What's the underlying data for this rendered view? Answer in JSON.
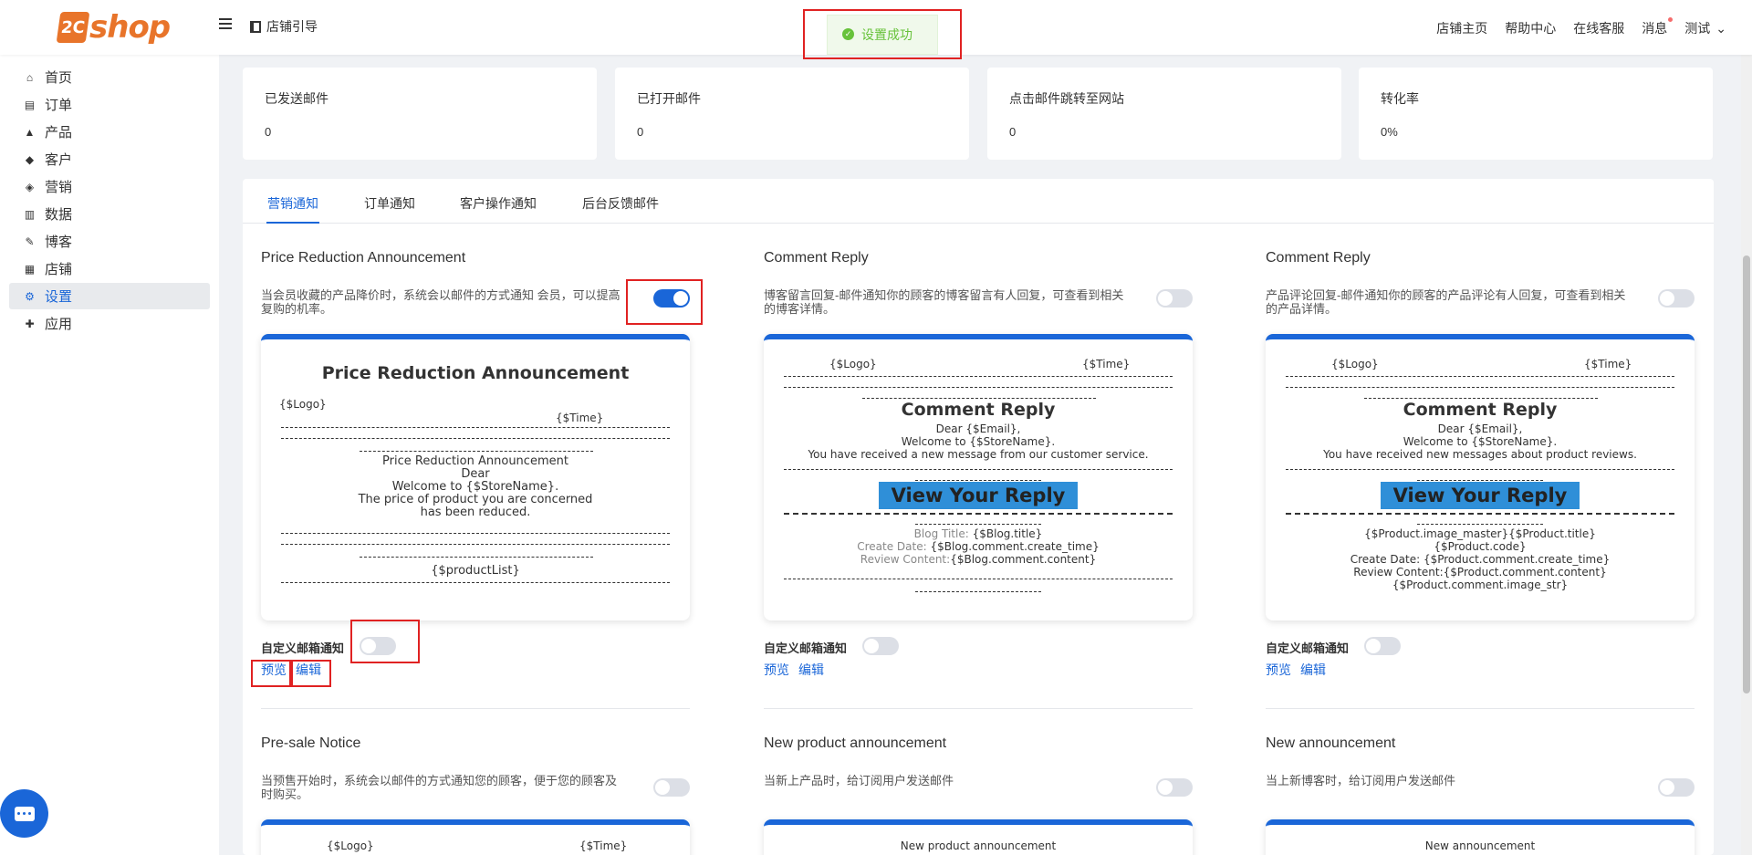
{
  "header": {
    "logo_mark": "2C",
    "logo_text": "shop",
    "guide_label": "店铺引导",
    "toast": "设置成功",
    "nav": [
      "店铺主页",
      "帮助中心",
      "在线客服",
      "消息"
    ],
    "user": "测试"
  },
  "sidebar": {
    "items": [
      {
        "label": "首页",
        "icon": "home-icon",
        "glyph": "⌂"
      },
      {
        "label": "订单",
        "icon": "clipboard-icon",
        "glyph": "▤"
      },
      {
        "label": "产品",
        "icon": "bag-icon",
        "glyph": "▲"
      },
      {
        "label": "客户",
        "icon": "diamond-icon",
        "glyph": "◆"
      },
      {
        "label": "营销",
        "icon": "tag-icon",
        "glyph": "◈"
      },
      {
        "label": "数据",
        "icon": "bar-chart-icon",
        "glyph": "▥"
      },
      {
        "label": "博客",
        "icon": "edit-icon",
        "glyph": "✎"
      },
      {
        "label": "店铺",
        "icon": "store-icon",
        "glyph": "▦"
      },
      {
        "label": "设置",
        "icon": "gear-icon",
        "glyph": "⚙"
      },
      {
        "label": "应用",
        "icon": "puzzle-icon",
        "glyph": "✚"
      }
    ],
    "active": "设置"
  },
  "stats": [
    {
      "label": "已发送邮件",
      "value": "0"
    },
    {
      "label": "已打开邮件",
      "value": "0"
    },
    {
      "label": "点击邮件跳转至网站",
      "value": "0"
    },
    {
      "label": "转化率",
      "value": "0%"
    }
  ],
  "tabs": [
    "营销通知",
    "订单通知",
    "客户操作通知",
    "后台反馈邮件"
  ],
  "common": {
    "custom_label": "自定义邮箱通知",
    "preview": "预览",
    "edit": "编辑"
  },
  "cards": [
    {
      "title": "Price Reduction Announcement",
      "desc": "当会员收藏的产品降价时，系统会以邮件的方式通知 会员，可以提高复购的机率。",
      "enabled": true,
      "custom_enabled": false,
      "pv": {
        "heading": "Price Reduction Announcement",
        "logo": "{$Logo}",
        "time": "{$Time}",
        "line1": "Price Reduction Announcement",
        "line2": "Dear",
        "line3": "Welcome to {$StoreName}.",
        "line4": "The price of product you are concerned",
        "line5": "has been reduced.",
        "footer": "{$productList}"
      }
    },
    {
      "title": "Comment Reply",
      "desc": "博客留言回复-邮件通知你的顾客的博客留言有人回复，可查看到相关的博客详情。",
      "enabled": false,
      "custom_enabled": false,
      "pv": {
        "logo": "{$Logo}",
        "time": "{$Time}",
        "heading": "Comment Reply",
        "line1": "Dear {$Email},",
        "line2": "Welcome to {$StoreName}.",
        "line3": "You have received a new message from our customer service.",
        "cta": "View Your Reply",
        "d1_label": "Blog Title:",
        "d1_value": "{$Blog.title}",
        "d2_label": "Create Date:",
        "d2_value": "{$Blog.comment.create_time}",
        "d3_label": "Review Content:",
        "d3_value": "{$Blog.comment.content}"
      }
    },
    {
      "title": "Comment Reply",
      "desc": "产品评论回复-邮件通知你的顾客的产品评论有人回复，可查看到相关的产品详情。",
      "enabled": false,
      "custom_enabled": false,
      "pv": {
        "logo": "{$Logo}",
        "time": "{$Time}",
        "heading": "Comment Reply",
        "line1": "Dear {$Email},",
        "line2": "Welcome to {$StoreName}.",
        "line3": "You have received new messages about product reviews.",
        "cta": "View Your Reply",
        "d1": "{$Product.image_master}{$Product.title}",
        "d2": "{$Product.code}",
        "d3": "Create Date: {$Product.comment.create_time}",
        "d4": "Review Content:{$Product.comment.content}",
        "d5": "{$Product.comment.image_str}"
      }
    },
    {
      "title": "Pre-sale Notice",
      "desc": "当预售开始时，系统会以邮件的方式通知您的顾客，便于您的顾客及时购买。",
      "enabled": false,
      "pv": {
        "logo": "{$Logo}",
        "time": "{$Time}"
      }
    },
    {
      "title": "New product announcement",
      "desc": "当新上产品时，给订阅用户发送邮件",
      "enabled": false,
      "pv": {
        "heading": "New product announcement"
      }
    },
    {
      "title": "New announcement",
      "desc": "当上新博客时，给订阅用户发送邮件",
      "enabled": false,
      "pv": {
        "heading": "New announcement"
      }
    }
  ],
  "colors": {
    "accent": "#1a66d8",
    "brand": "#e8742a",
    "success": "#67c23a",
    "highlight": "#e02222"
  }
}
